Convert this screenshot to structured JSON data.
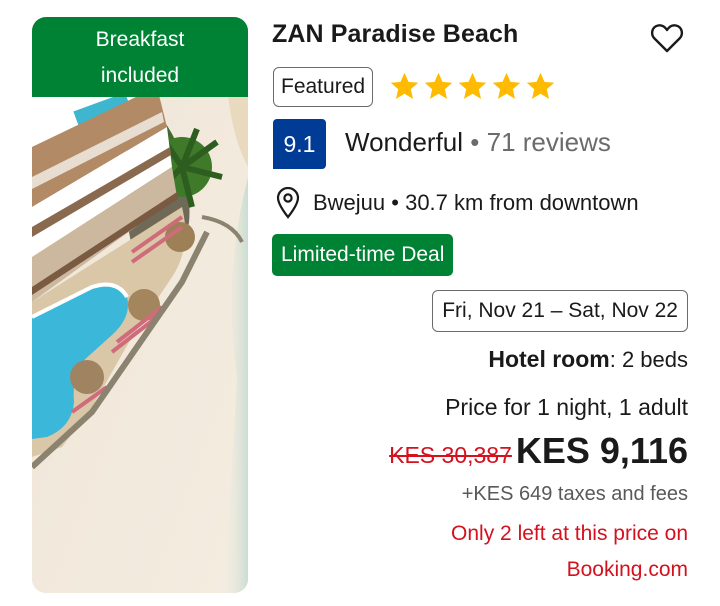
{
  "badge": {
    "line1": "Breakfast",
    "line2": "included"
  },
  "hotel": {
    "name": "ZAN Paradise Beach"
  },
  "icons": {
    "favorite": "heart-outline-icon",
    "location": "map-pin-icon",
    "star": "star-icon"
  },
  "featured_label": "Featured",
  "stars": {
    "count": 5,
    "color": "#febb02"
  },
  "rating": {
    "score": "9.1",
    "word": "Wonderful",
    "separator": "•",
    "reviews": "71 reviews"
  },
  "location": {
    "text": "Bwejuu • 30.7 km from downtown"
  },
  "deal_label": "Limited-time Deal",
  "dates": "Fri, Nov 21 – Sat, Nov 22",
  "room": {
    "type": "Hotel room",
    "beds": ": 2 beds"
  },
  "price": {
    "for": "Price for 1 night, 1 adult",
    "original": "KES 30,387",
    "current": "KES 9,116",
    "taxes": "+KES 649 taxes and fees",
    "availability_line1": "Only 2 left at this price on",
    "availability_line2": "Booking.com"
  },
  "colors": {
    "green": "#008234",
    "blue": "#003b95",
    "red": "#d4111e",
    "star": "#febb02"
  }
}
